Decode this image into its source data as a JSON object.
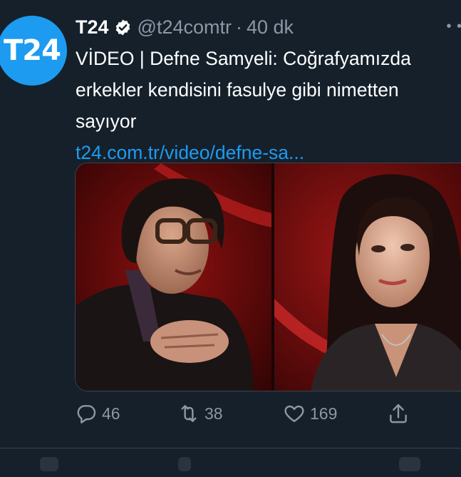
{
  "tweet": {
    "avatar_text": "T24",
    "display_name": "T24",
    "handle": "@t24comtr",
    "separator": "·",
    "time": "40 dk",
    "more_label": "• •",
    "text": "VİDEO | Defne Samyeli: Coğrafyamızda erkekler kendisini fasulye gibi nimetten sayıyor",
    "link": "t24.com.tr/video/defne-sa..."
  },
  "actions": {
    "reply_count": "46",
    "retweet_count": "38",
    "like_count": "169"
  },
  "icons": {
    "verified": "verified-badge-icon",
    "reply": "reply-icon",
    "retweet": "retweet-icon",
    "like": "heart-icon",
    "share": "share-icon",
    "more": "more-icon"
  },
  "colors": {
    "background": "#15202b",
    "accent": "#1d9bf0",
    "secondary_text": "#8b98a5",
    "border": "#38444d"
  }
}
